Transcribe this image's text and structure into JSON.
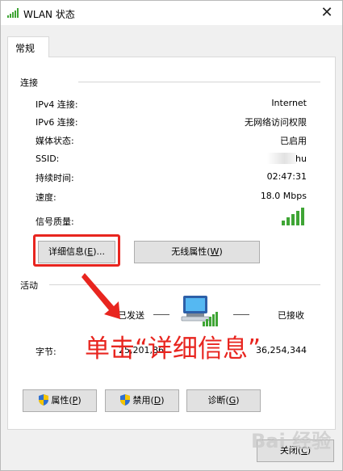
{
  "window": {
    "title": "WLAN 状态",
    "close_glyph": "✕"
  },
  "tabs": [
    {
      "label": "常规"
    }
  ],
  "connection": {
    "group_label": "连接",
    "rows": [
      {
        "label": "IPv4 连接:",
        "value": "Internet"
      },
      {
        "label": "IPv6 连接:",
        "value": "无网络访问权限"
      },
      {
        "label": "媒体状态:",
        "value": "已启用"
      },
      {
        "label": "SSID:",
        "value": "hu"
      },
      {
        "label": "持续时间:",
        "value": "02:47:31"
      },
      {
        "label": "速度:",
        "value": "18.0 Mbps"
      },
      {
        "label": "信号质量:",
        "value": ""
      }
    ],
    "signal_bars": 5
  },
  "buttons": {
    "details": {
      "label": "详细信息(",
      "mnemonic": "E",
      "suffix": ")..."
    },
    "wireless_props": {
      "label": "无线属性(",
      "mnemonic": "W",
      "suffix": ")"
    },
    "properties": {
      "label": "属性(",
      "mnemonic": "P",
      "suffix": ")"
    },
    "disable": {
      "label": "禁用(",
      "mnemonic": "D",
      "suffix": ")"
    },
    "diagnose": {
      "label": "诊断(",
      "mnemonic": "G",
      "suffix": ")"
    },
    "close": {
      "label": "关闭(",
      "mnemonic": "C",
      "suffix": ")"
    }
  },
  "activity": {
    "group_label": "活动",
    "sent_label": "已发送",
    "received_label": "已接收",
    "bytes_label": "字节:",
    "bytes_sent": "25,201,86",
    "bytes_received": "36,254,344"
  },
  "annotation": {
    "text": "单击“详细信息”"
  },
  "watermark": {
    "text": "Bai 经验"
  },
  "colors": {
    "annotation_red": "#e8251f",
    "signal_green": "#3fa535"
  }
}
